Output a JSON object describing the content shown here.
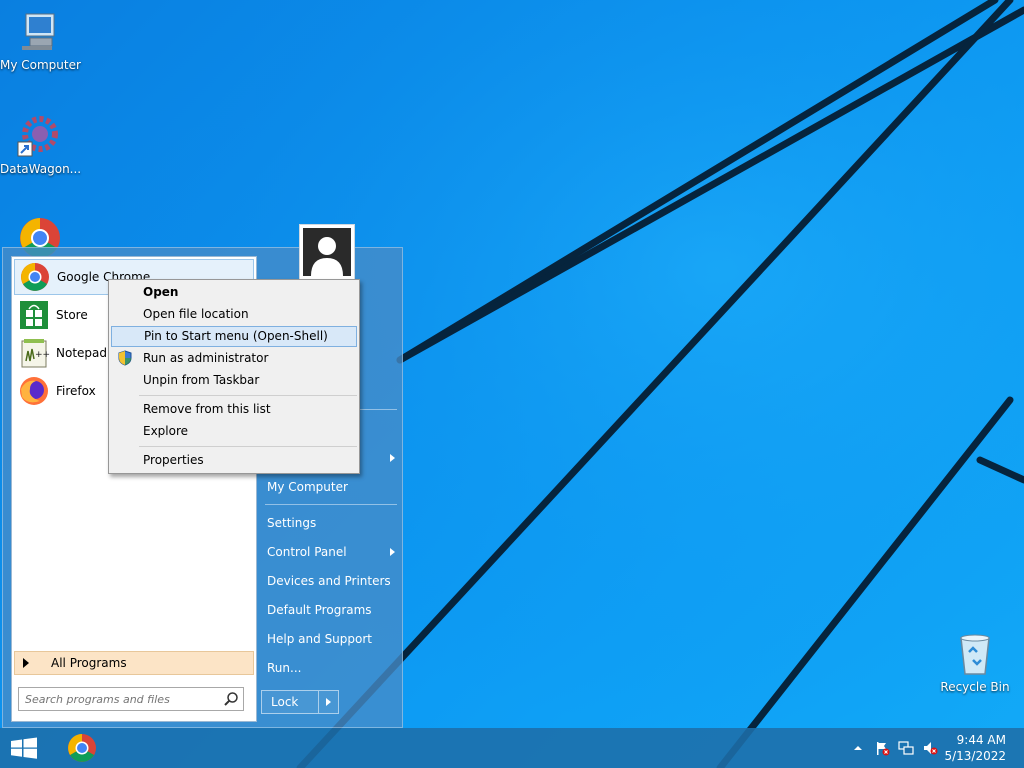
{
  "desktop": {
    "icons": [
      {
        "label": "My Computer",
        "icon": "computer-icon"
      },
      {
        "label": "DataWagon...",
        "icon": "gear-shortcut-icon"
      },
      {
        "label": "Recycle Bin",
        "icon": "recycle-bin-icon"
      }
    ]
  },
  "start_menu": {
    "programs": [
      {
        "label": "Google Chrome",
        "icon": "chrome-icon"
      },
      {
        "label": "Store",
        "icon": "store-icon"
      },
      {
        "label": "Notepad++",
        "icon": "notepad-plus-plus-icon"
      },
      {
        "label": "Firefox",
        "icon": "firefox-icon"
      }
    ],
    "all_programs": "All Programs",
    "search_placeholder": "Search programs and files",
    "right_items": {
      "my_computer": "My Computer",
      "settings": "Settings",
      "control_panel": "Control Panel",
      "devices_printers": "Devices and Printers",
      "default_programs": "Default Programs",
      "help_support": "Help and Support",
      "run": "Run..."
    },
    "lock": "Lock"
  },
  "context_menu": {
    "items": [
      {
        "label": "Open",
        "bold": true
      },
      {
        "label": "Open file location"
      },
      {
        "label": "Pin to Start menu (Open-Shell)",
        "highlighted": true
      },
      {
        "label": "Run as administrator",
        "icon": "uac-shield-icon"
      },
      {
        "label": "Unpin from Taskbar"
      },
      {
        "label": "Remove from this list"
      },
      {
        "label": "Explore"
      },
      {
        "label": "Properties"
      }
    ]
  },
  "taskbar": {
    "pinned": [
      "windows-logo-icon",
      "chrome-icon"
    ],
    "tray_icons": [
      "chevron-up-icon",
      "action-center-flag-icon",
      "network-icon",
      "volume-muted-icon"
    ],
    "time": "9:44 AM",
    "date": "5/13/2022"
  },
  "colors": {
    "desktop": "#0b94f0",
    "context_highlight": "#d8e8f8",
    "all_programs_bg": "#fce4c6"
  }
}
